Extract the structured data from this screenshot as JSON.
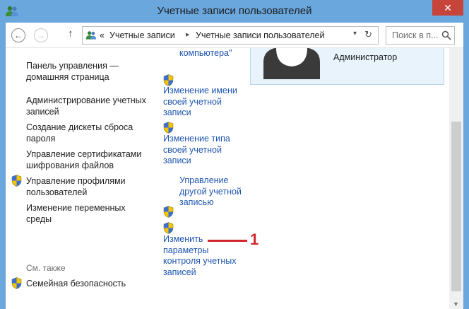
{
  "window": {
    "title": "Учетные записи пользователей",
    "close_label": "✕"
  },
  "toolbar": {
    "back_label": "←",
    "forward_label": "→",
    "up_label": "↑",
    "breadcrumb": {
      "prefix": "«",
      "items": [
        "Учетные записи",
        "Учетные записи пользователей"
      ],
      "separator": "▸"
    },
    "dropdown_label": "▾",
    "refresh_label": "↻",
    "search_placeholder": "Поиск в п..."
  },
  "sidebar": {
    "links": [
      {
        "label": "Панель управления — домашняя страница",
        "shield": false
      },
      {
        "label": "Администрирование учетных записей",
        "shield": false
      },
      {
        "label": "Создание дискеты сброса пароля",
        "shield": false
      },
      {
        "label": "Управление сертификатами шифрования файлов",
        "shield": false
      },
      {
        "label": "Управление профилями пользователей",
        "shield": true
      },
      {
        "label": "Изменение переменных среды",
        "shield": false
      }
    ],
    "see_also_title": "См. также",
    "see_also_links": [
      {
        "label": "Семейная безопасность",
        "shield": true
      }
    ]
  },
  "tasks": {
    "partial_top": "компьютера\"",
    "items": [
      {
        "label": "Изменение имени своей учетной записи",
        "shield": true
      },
      {
        "label": "Изменение типа своей учетной записи",
        "shield": true
      },
      {
        "label": "Управление другой учетной записью",
        "shield": true
      },
      {
        "label": "Изменить параметры контроля учетных записей",
        "shield": true
      }
    ]
  },
  "user": {
    "role": "Администратор"
  },
  "annotation": {
    "number": "1"
  },
  "colors": {
    "frame": "#6aa7dd",
    "close": "#c7443a",
    "link": "#1f56b0",
    "annotation": "#d3262e"
  },
  "icons": {
    "system": "users-icon",
    "shield": "uac-shield-icon",
    "search": "search-icon",
    "refresh": "refresh-icon"
  }
}
